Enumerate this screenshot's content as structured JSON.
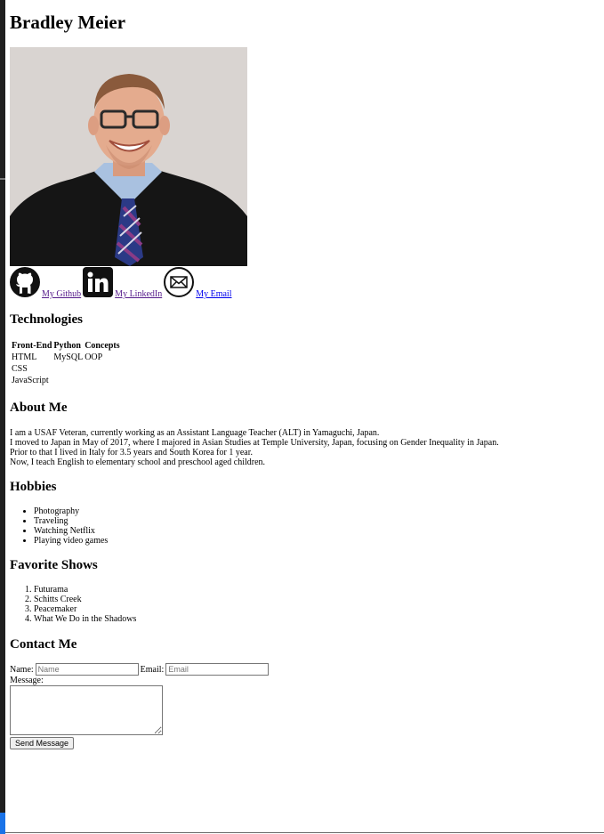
{
  "header": {
    "name": "Bradley Meier"
  },
  "profile_photo": {
    "alt": "Photo of Bradley Meier"
  },
  "links": [
    {
      "icon": "github-icon",
      "label": "My Github"
    },
    {
      "icon": "linkedin-icon",
      "label": "My LinkedIn"
    },
    {
      "icon": "email-icon",
      "label": "My Email"
    }
  ],
  "technologies": {
    "heading": "Technologies",
    "columns": [
      "Front-End",
      "Python",
      "Concepts"
    ],
    "rows": [
      [
        "HTML",
        "MySQL",
        "OOP"
      ],
      [
        "CSS",
        "",
        ""
      ],
      [
        "JavaScript",
        "",
        ""
      ]
    ]
  },
  "about": {
    "heading": "About Me",
    "lines": [
      "I am a USAF Veteran, currently working as an Assistant Language Teacher (ALT) in Yamaguchi, Japan.",
      "I moved to Japan in May of 2017, where I majored in Asian Studies at Temple University, Japan, focusing on Gender Inequality in Japan.",
      "Prior to that I lived in Italy for 3.5 years and South Korea for 1 year.",
      "Now, I teach English to elementary school and preschool aged children."
    ]
  },
  "hobbies": {
    "heading": "Hobbies",
    "items": [
      "Photography",
      "Traveling",
      "Watching Netflix",
      "Playing video games"
    ]
  },
  "shows": {
    "heading": "Favorite Shows",
    "items": [
      "Futurama",
      "Schitts Creek",
      "Peacemaker",
      "What We Do in the Shadows"
    ]
  },
  "contact": {
    "heading": "Contact Me",
    "name_label": "Name:",
    "name_placeholder": "Name",
    "email_label": "Email:",
    "email_placeholder": "Email",
    "message_label": "Message:",
    "submit_label": "Send Message"
  }
}
